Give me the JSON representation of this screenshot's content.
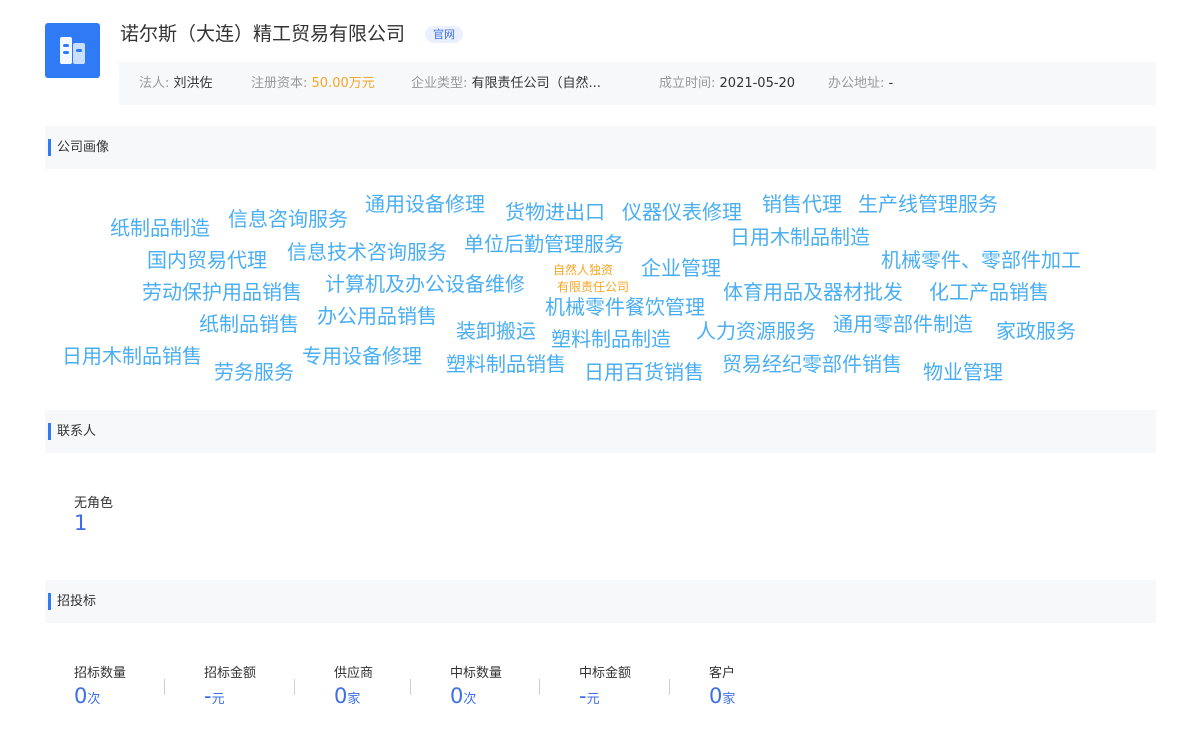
{
  "company": {
    "name": "诺尔斯（大连）精工贸易有限公司",
    "official_tag": "官网"
  },
  "info": {
    "legal_person_label": "法人:",
    "legal_person": "刘洪佐",
    "capital_label": "注册资本:",
    "capital": "50.00万元",
    "type_label": "企业类型:",
    "type": "有限责任公司（自然...",
    "founded_label": "成立时间:",
    "founded": "2021-05-20",
    "address_label": "办公地址:",
    "address": "-"
  },
  "portrait": {
    "title": "公司画像",
    "words": [
      "纸制品制造",
      "信息咨询服务",
      "通用设备修理",
      "货物进出口",
      "仪器仪表修理",
      "销售代理",
      "生产线管理服务",
      "单位后勤管理服务",
      "日用木制品制造",
      "国内贸易代理",
      "信息技术咨询服务",
      "自然人独资",
      "有限责任公司",
      "企业管理",
      "机械零件、零部件加工",
      "劳动保护用品销售",
      "计算机及办公设备维修",
      "机械零件餐饮管理",
      "体育用品及器材批发",
      "化工产品销售",
      "纸制品销售",
      "办公用品销售",
      "装卸搬运",
      "塑料制品制造",
      "人力资源服务",
      "通用零部件制造",
      "家政服务",
      "日用木制品销售",
      "劳务服务",
      "专用设备修理",
      "塑料制品销售",
      "日用百货销售",
      "贸易经纪零部件销售",
      "物业管理"
    ]
  },
  "contacts": {
    "title": "联系人",
    "role_label": "无角色",
    "role_count": "1"
  },
  "bidding": {
    "title": "招投标",
    "stats": [
      {
        "label": "招标数量",
        "value": "0",
        "unit": "次"
      },
      {
        "label": "招标金额",
        "value": "-",
        "unit": "元"
      },
      {
        "label": "供应商",
        "value": "0",
        "unit": "家"
      },
      {
        "label": "中标数量",
        "value": "0",
        "unit": "次"
      },
      {
        "label": "中标金额",
        "value": "-",
        "unit": "元"
      },
      {
        "label": "客户",
        "value": "0",
        "unit": "家"
      }
    ]
  },
  "colors": {
    "accent": "#2f7bf5",
    "cloud_blue": "#4aaef2",
    "highlight_orange": "#f5a623"
  }
}
